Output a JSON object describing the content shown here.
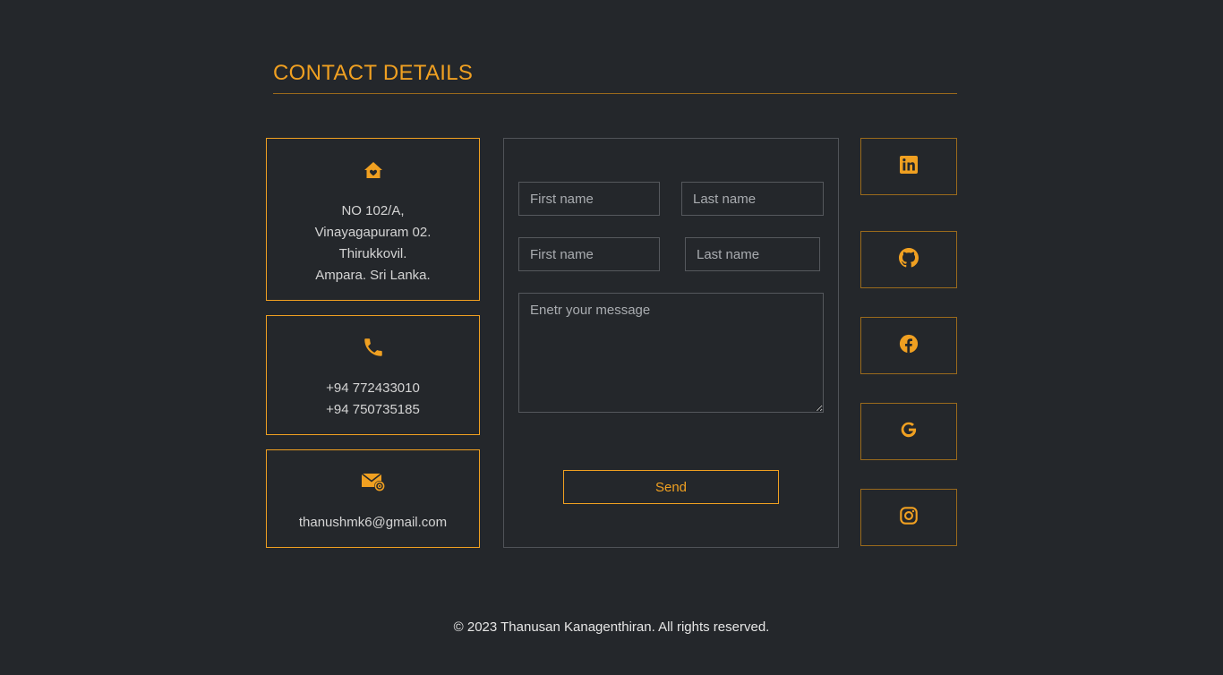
{
  "title": "CONTACT DETAILS",
  "address": {
    "icon": "home-heart-icon",
    "line1": "NO 102/A,",
    "line2": "Vinayagapuram 02.",
    "line3": "Thirukkovil.",
    "line4": "Ampara. Sri Lanka."
  },
  "phone": {
    "icon": "phone-icon",
    "number1": "+94 772433010",
    "number2": "+94 750735185"
  },
  "email": {
    "icon": "email-at-icon",
    "address": "thanushmk6@gmail.com"
  },
  "form": {
    "first_name_1": "First name",
    "last_name_1": "Last name",
    "first_name_2": "First name",
    "last_name_2": "Last name",
    "message_placeholder": "Enetr your message",
    "send_label": "Send"
  },
  "social": [
    {
      "icon": "linkedin-icon"
    },
    {
      "icon": "github-icon"
    },
    {
      "icon": "facebook-icon"
    },
    {
      "icon": "google-icon"
    },
    {
      "icon": "instagram-icon"
    }
  ],
  "footer": "© 2023 Thanusan Kanagenthiran. All rights reserved.",
  "colors": {
    "accent": "#f0a021",
    "background": "#24272b",
    "text": "#d4d4d4"
  }
}
